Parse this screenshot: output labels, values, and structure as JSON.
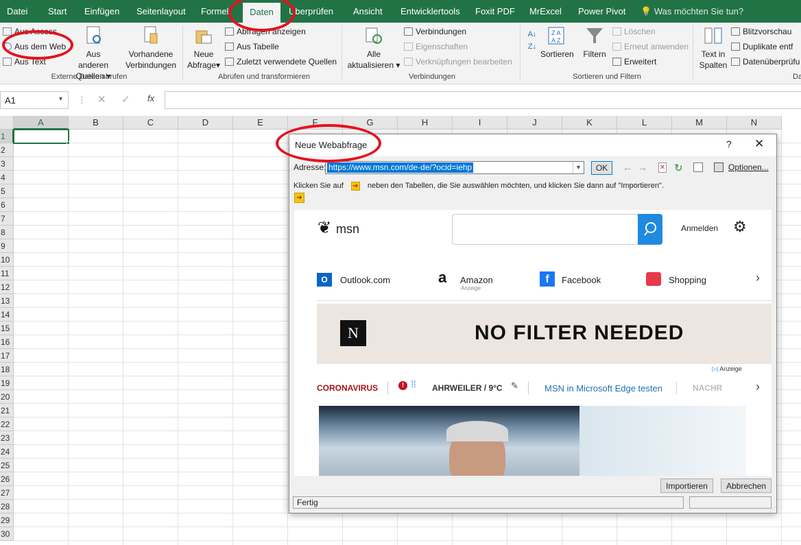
{
  "menubar": {
    "tabs": [
      "Datei",
      "Start",
      "Einfügen",
      "Seitenlayout",
      "Formel",
      "Daten",
      "Überprüfen",
      "Ansicht",
      "Entwicklertools",
      "Foxit PDF",
      "MrExcel",
      "Power Pivot"
    ],
    "tell_me": "Was möchten Sie tun?"
  },
  "ribbon": {
    "groups": [
      {
        "label": "Externe Daten abrufen",
        "items": [
          "Aus Access",
          "Aus dem Web",
          "Aus Text",
          "Aus anderen",
          "Quellen",
          "Vorhandene",
          "Verbindungen"
        ]
      },
      {
        "label": "Abrufen und transformieren",
        "items": [
          "Neue",
          "Abfrage",
          "Abfragen anzeigen",
          "Aus Tabelle",
          "Zuletzt verwendete Quellen"
        ]
      },
      {
        "label": "Verbindungen",
        "items": [
          "Alle",
          "aktualisieren",
          "Verbindungen",
          "Eigenschaften",
          "Verknüpfungen bearbeiten"
        ]
      },
      {
        "label": "Sortieren und Filtern",
        "items": [
          "Sortieren",
          "Filtern",
          "Löschen",
          "Erneut anwenden",
          "Erweitert"
        ]
      },
      {
        "label": "Da",
        "items": [
          "Text in",
          "Spalten",
          "Blitzvorschau",
          "Duplikate entf",
          "Datenüberprüfu"
        ]
      }
    ]
  },
  "formula_bar": {
    "cell_ref": "A1",
    "fx": "fx"
  },
  "sheet": {
    "columns": [
      "A",
      "B",
      "C",
      "D",
      "E",
      "F",
      "G",
      "H",
      "I",
      "J",
      "K",
      "L",
      "M",
      "N"
    ],
    "rows": [
      "1",
      "2",
      "3",
      "4",
      "5",
      "6",
      "7",
      "8",
      "9",
      "10",
      "11",
      "12",
      "13",
      "14",
      "15",
      "16",
      "17",
      "18",
      "19",
      "20",
      "21",
      "22",
      "23",
      "24",
      "25",
      "26",
      "27",
      "28",
      "29",
      "30"
    ]
  },
  "dialog": {
    "title": "Neue Webabfrage",
    "help": "?",
    "close": "✕",
    "address_label": "Adresse:",
    "address_value": "https://www.msn.com/de-de/?ocid=iehp",
    "ok": "OK",
    "options": "Optionen...",
    "instruction_a": "Klicken Sie auf",
    "instruction_b": "neben den Tabellen, die Sie auswählen möchten, und klicken Sie dann auf \"Importieren\".",
    "import": "Importieren",
    "cancel": "Abbrechen",
    "status": "Fertig"
  },
  "msn": {
    "logo": "msn",
    "signin": "Anmelden",
    "links": [
      {
        "label": "Outlook.com",
        "sub": ""
      },
      {
        "label": "Amazon",
        "sub": "Anzeige"
      },
      {
        "label": "Facebook",
        "sub": ""
      },
      {
        "label": "Shopping",
        "sub": ""
      }
    ],
    "ad_text": "NO FILTER NEEDED",
    "ad_badge": "Anzeige",
    "news": {
      "corona": "CORONAVIRUS",
      "weather": "AHRWEILER / 9°C",
      "edge": "MSN in Microsoft Edge testen",
      "more": "NACHR"
    }
  },
  "colors": {
    "excel_green": "#217346",
    "annotation_red": "#e3131f",
    "msn_blue": "#1f8ae0"
  }
}
